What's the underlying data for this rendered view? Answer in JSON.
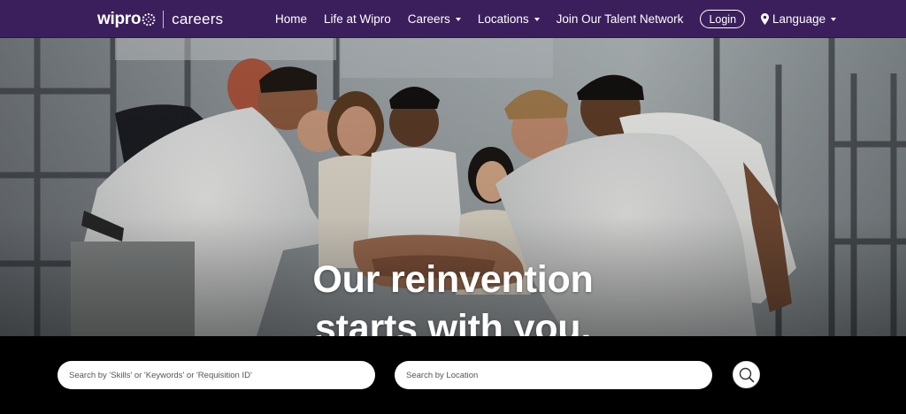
{
  "brand": {
    "logo_text": "wipro",
    "section": "careers"
  },
  "nav": {
    "items": [
      {
        "label": "Home",
        "has_caret": false
      },
      {
        "label": "Life at Wipro",
        "has_caret": false
      },
      {
        "label": "Careers",
        "has_caret": true
      },
      {
        "label": "Locations",
        "has_caret": true
      },
      {
        "label": "Join Our Talent Network",
        "has_caret": false
      }
    ],
    "login_label": "Login",
    "language_label": "Language"
  },
  "hero": {
    "headline_line1": "Our reinvention",
    "headline_line2": "starts with you."
  },
  "search": {
    "keywords_placeholder": "Search by 'Skills' or 'Keywords' or 'Requisition ID'",
    "location_placeholder": "Search by Location",
    "search_button_icon": "search-icon"
  },
  "colors": {
    "nav_background": "#3b1f5c",
    "search_strip_background": "#000000",
    "text": "#ffffff"
  }
}
